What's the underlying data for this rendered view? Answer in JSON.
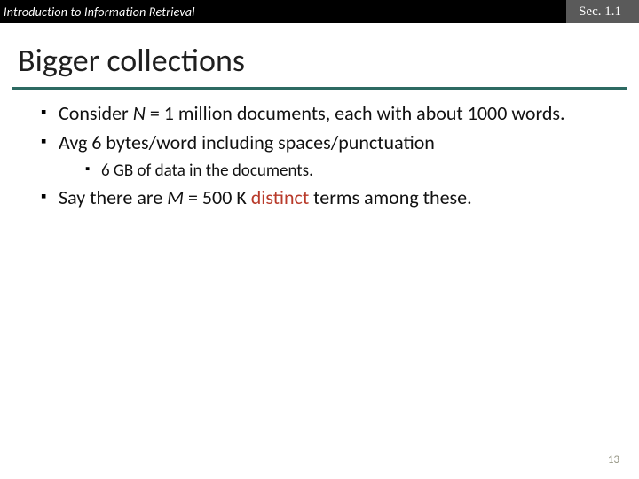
{
  "header": {
    "left": "Introduction to Information Retrieval",
    "right": "Sec. 1.1"
  },
  "title": "Bigger collections",
  "bullets": {
    "b1_pre": "Consider ",
    "b1_var": "N",
    "b1_post": " = 1 million documents, each with about 1000 words.",
    "b2": "Avg 6 bytes/word including spaces/punctuation",
    "b2_sub": "6 GB of data in the documents.",
    "b3_pre": "Say there are ",
    "b3_var": "M",
    "b3_mid": " = 500 K ",
    "b3_em": "distinct",
    "b3_post": " terms among these."
  },
  "pagenum": "13"
}
